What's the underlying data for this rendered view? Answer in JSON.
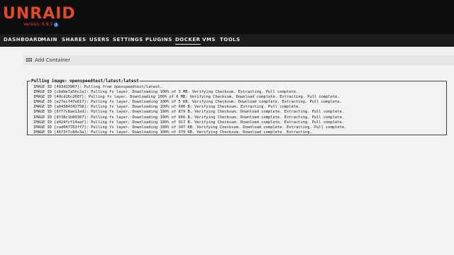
{
  "header": {
    "logo": "UNRAID",
    "version": "Version: 6.8.3",
    "info_icon": "info-icon"
  },
  "nav": {
    "items": [
      {
        "label": "DASHBOARD"
      },
      {
        "label": "MAIN"
      },
      {
        "label": "SHARES"
      },
      {
        "label": "USERS"
      },
      {
        "label": "SETTINGS"
      },
      {
        "label": "PLUGINS"
      },
      {
        "label": "DOCKER"
      },
      {
        "label": "VMS"
      },
      {
        "label": "TOOLS"
      }
    ],
    "active": "DOCKER"
  },
  "section": {
    "title": "Add Container",
    "icon": "grid-icon"
  },
  "pull": {
    "legend": "Pulling image: openspeedtest/latest:latest",
    "lines": [
      "IMAGE ID [493433967]: Pulling from openspeedtest/latest.",
      "IMAGE ID [cbdbe7a5bc2a]: Pulling fs layer. Downloading 100% of 3 MB. Verifying Checksum. Extracting. Pull complete.",
      "IMAGE ID [49cd16c2007]: Pulling fs layer. Downloading 100% of 6 MB. Verifying Checksum. Download complete. Extracting. Pull complete.",
      "IMAGE ID [e27ecf47e617]: Pulling fs layer. Downloading 100% of 5 KB. Verifying Checksum. Download complete. Extracting. Pull complete.",
      "IMAGE ID [a04384342758]: Pulling fs layer. Downloading 100% of 600 B. Verifying Checksum. Extracting. Pull complete.",
      "IMAGE ID [67f7c8ae11ed]: Pulling fs layer. Downloading 100% of 879 B. Verifying Checksum. Download complete. Extracting. Pull complete.",
      "IMAGE ID [8f38c1b80367]: Pulling fs layer. Downloading 100% of 666 B. Verifying Checksum. Download complete. Extracting. Pull complete.",
      "IMAGE ID [d424fcf14aaf]: Pulling fs layer. Downloading 100% of 917 B. Verifying Checksum. Download complete. Extracting. Pull complete.",
      "IMAGE ID [cad047763ff7]: Pulling fs layer. Downloading 100% of 347 KB. Verifying Checksum. Download complete. Extracting. Pull complete.",
      "IMAGE ID [4673f7c84c3a]: Pulling fs layer. Downloading 100% of 379 KB. Verifying Checksum. Download complete. Extracting."
    ]
  },
  "colors": {
    "brand": "#e24a2a",
    "header_bg": "#0d0d0d",
    "nav_bg": "#1c1c1c",
    "page_bg": "#f2f2f2"
  }
}
